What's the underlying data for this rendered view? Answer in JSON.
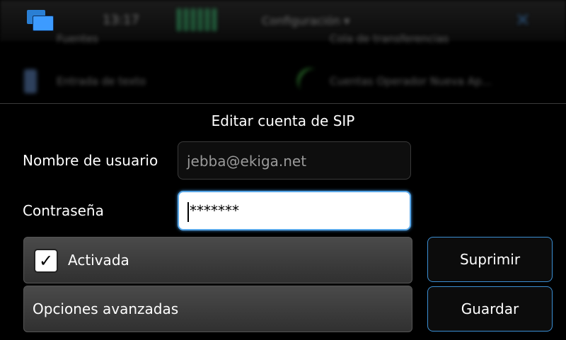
{
  "status_bar": {
    "clock": "13:17",
    "title": "Configuración ▾",
    "close_glyph": "✕",
    "switcher_icon": "task-switcher-icon"
  },
  "background_grid": {
    "items": [
      {
        "label": "Fuentes"
      },
      {
        "label": "Cola de transferencias"
      },
      {
        "label": "Entrada de texto"
      },
      {
        "label": "Cuentas Operador Nueva Ap..."
      }
    ]
  },
  "dialog": {
    "title": "Editar cuenta de SIP",
    "username": {
      "label": "Nombre de usuario",
      "value": "jebba@ekiga.net"
    },
    "password": {
      "label": "Contraseña",
      "value": "*******"
    },
    "enabled": {
      "label": "Activada",
      "checked": true,
      "check_glyph": "✓"
    },
    "advanced": {
      "label": "Opciones avanzadas"
    },
    "delete_button": "Suprimir",
    "save_button": "Guardar"
  },
  "colors": {
    "accent": "#3b8fd4",
    "background": "#000000"
  }
}
